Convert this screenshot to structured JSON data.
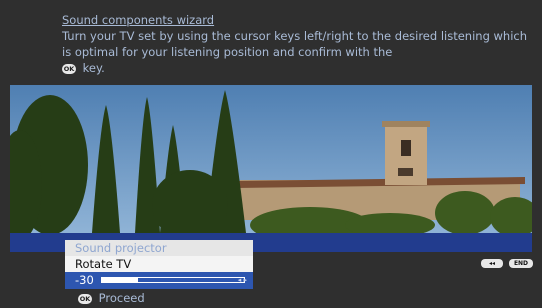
{
  "wizard": {
    "title": "Sound components wizard",
    "instruction": "Turn your TV set by using the cursor keys left/right to the desired listening which is optimal for your listening position and confirm with the",
    "ok_badge": "OK",
    "instruction_end": "key."
  },
  "menu": {
    "items": [
      {
        "label": "Sound projector"
      },
      {
        "label": "Rotate TV"
      }
    ],
    "slider": {
      "value": "-30",
      "arrows": "◂ ▸",
      "level_fraction": 0.25
    }
  },
  "footer": {
    "ok_badge": "OK",
    "proceed_label": "Proceed",
    "back_button": "◂◂",
    "end_button": "END"
  },
  "colors": {
    "background": "#2f2f2f",
    "text": "#a9bbd6",
    "highlight_bar": "#223c8e",
    "selected_row": "#2d56b0"
  }
}
